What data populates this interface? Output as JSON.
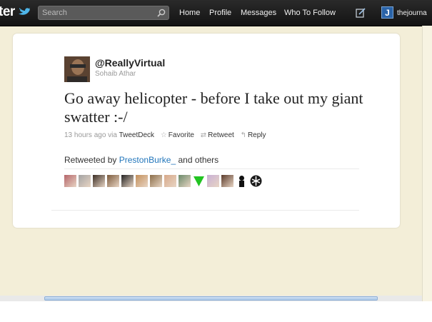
{
  "topbar": {
    "logo": "ter",
    "search_placeholder": "Search",
    "nav": [
      "Home",
      "Profile",
      "Messages",
      "Who To Follow"
    ],
    "avatar_letter": "J",
    "username": "thejourna"
  },
  "tweet": {
    "handle": "@ReallyVirtual",
    "name": "Sohaib Athar",
    "text": "Go away helicopter - before I take out my giant swatter :-/",
    "time": "13 hours ago",
    "via": "via",
    "source": "TweetDeck",
    "favorite_label": "Favorite",
    "retweet_label": "Retweet",
    "reply_label": "Reply",
    "retweeted_by_prefix": "Retweeted by",
    "retweeted_by_user": "PrestonBurke_",
    "retweeted_by_suffix": "and others"
  },
  "retweeter_avatar_colors": [
    "#b5656a",
    "#a3a3a3",
    "#3a2d24",
    "#7b5a3c",
    "#222222",
    "#c38f5a",
    "#8b6e4a",
    "#d7a98a",
    "#6a8a6a",
    "#22c422",
    "#c9b0d6",
    "#5a3a2a",
    "#111111",
    "#1a1a1a"
  ],
  "colors": {
    "link": "#2276bb",
    "background": "#f3eed8"
  }
}
